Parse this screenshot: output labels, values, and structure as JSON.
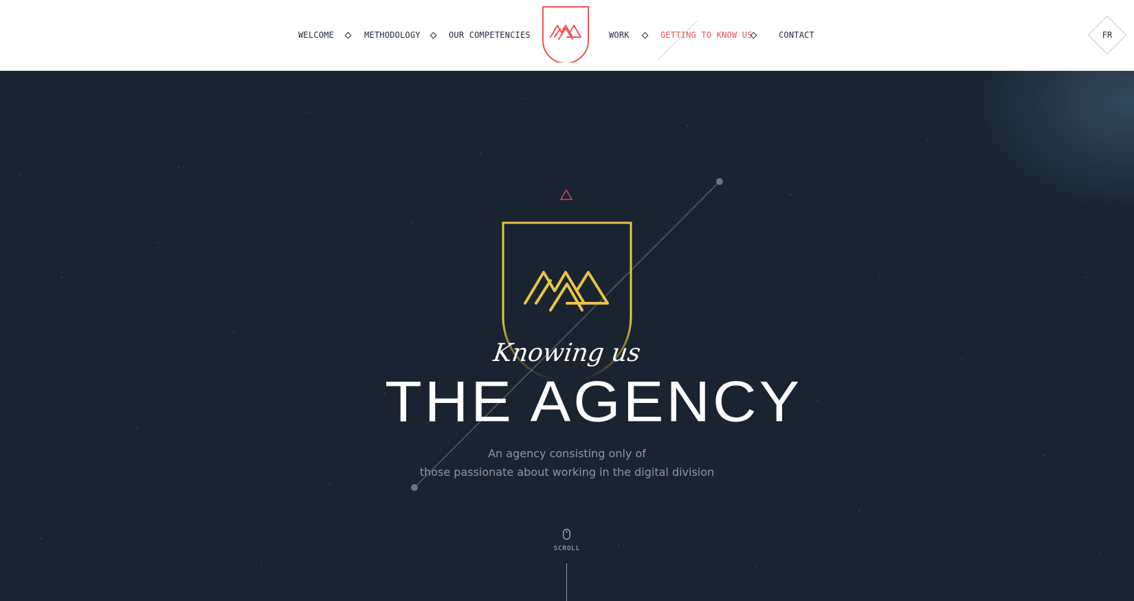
{
  "header": {
    "nav_left": [
      {
        "label": "WELCOME"
      },
      {
        "label": "METHODOLOGY"
      },
      {
        "label": "OUR COMPETENCIES"
      }
    ],
    "nav_right": [
      {
        "label": "WORK"
      },
      {
        "label": "GETTING TO KNOW US",
        "active": true
      },
      {
        "label": "CONTACT"
      }
    ],
    "language_toggle": "FR",
    "logo_icon": "m-mountain-shield-logo-icon"
  },
  "hero": {
    "script_title": "Knowing us",
    "title": "THE AGENCY",
    "description_line1": "An agency consisting only of",
    "description_line2": "those passionate about working in the digital division",
    "crest_icon": "m-mountain-crest-icon",
    "scroll_label": "SCROLL"
  },
  "colors": {
    "accent_red": "#f0544f",
    "crest_gold": "#e8c547",
    "hero_background": "#1a2430",
    "nav_text": "#1f2a36",
    "description_gray": "#8f969e"
  }
}
